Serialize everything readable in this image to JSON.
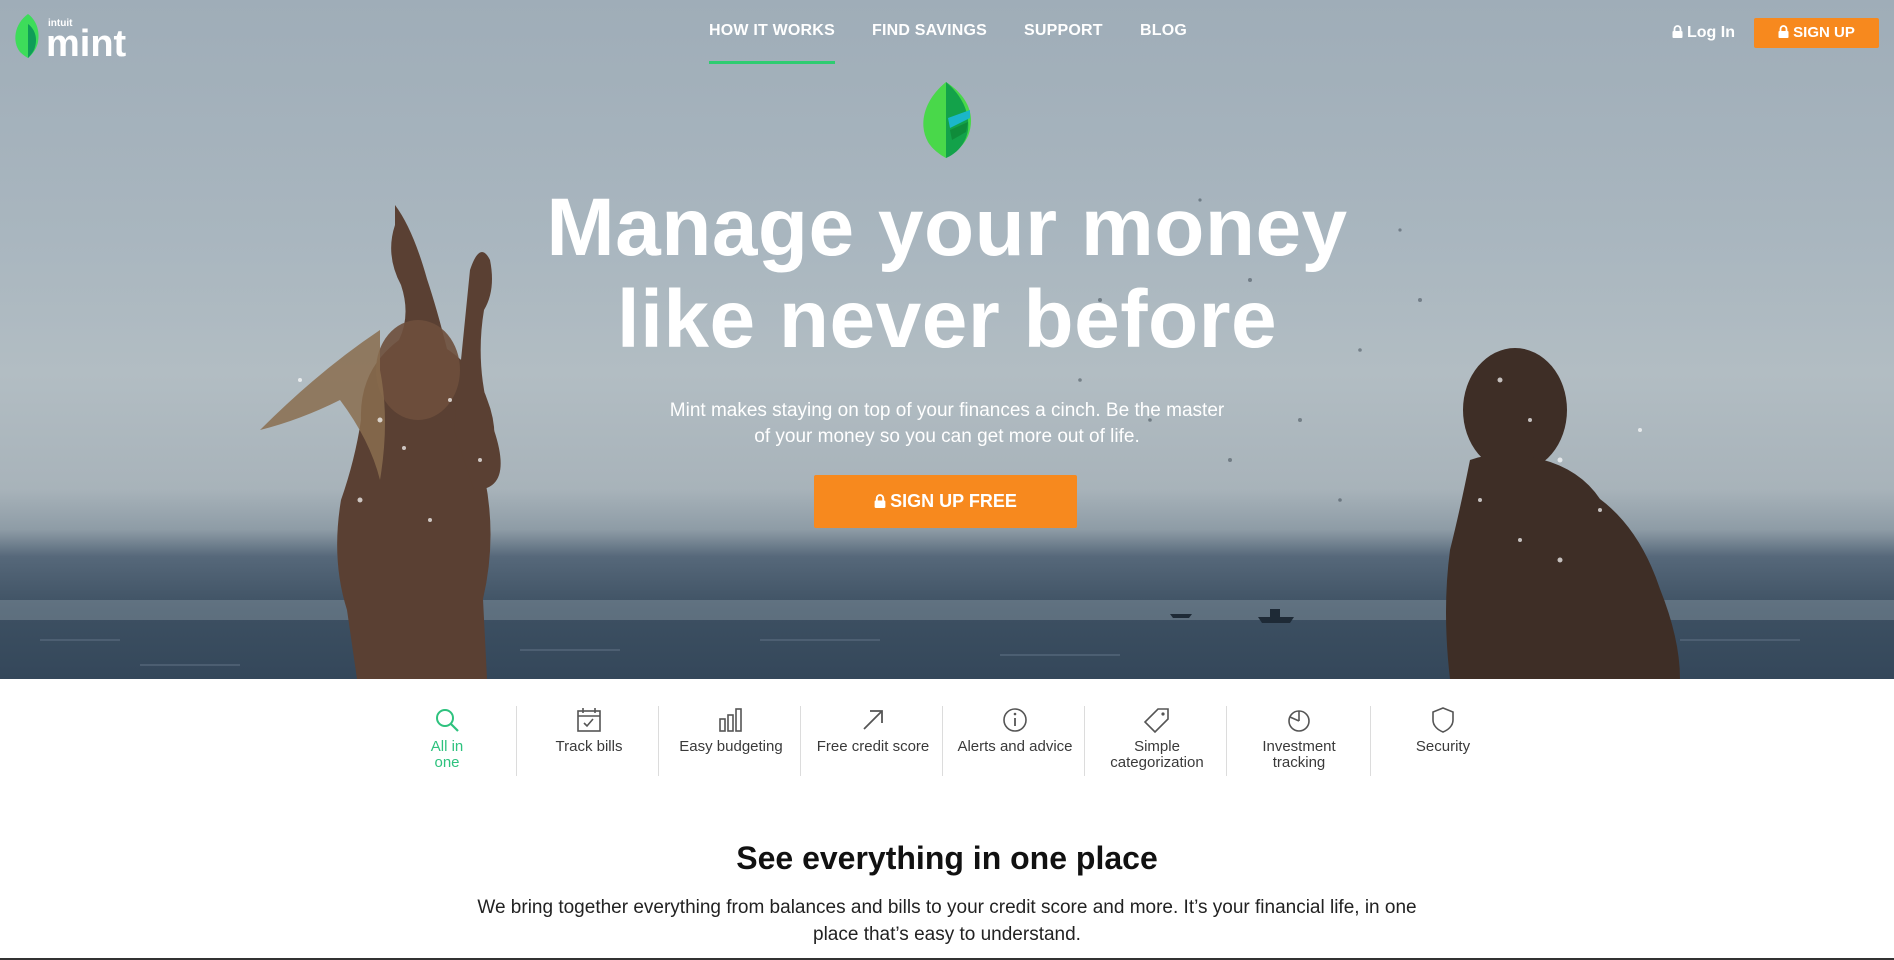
{
  "brand": {
    "small_text": "intuit",
    "name": "mint",
    "colors": {
      "green": "#2ecc71",
      "orange": "#f7891e"
    }
  },
  "nav": {
    "items": [
      {
        "label": "HOW IT WORKS",
        "active": true
      },
      {
        "label": "FIND SAVINGS",
        "active": false
      },
      {
        "label": "SUPPORT",
        "active": false
      },
      {
        "label": "BLOG",
        "active": false
      }
    ],
    "login_label": "Log In",
    "signup_label": "SIGN UP"
  },
  "hero": {
    "headline_line1": "Manage your money",
    "headline_line2": "like never before",
    "subtext_line1": "Mint makes staying on top of your finances a cinch. Be the master",
    "subtext_line2": "of your money so you can get more out of life.",
    "cta_label": "SIGN UP FREE"
  },
  "features": [
    {
      "label": "All in one",
      "icon": "search-icon",
      "active": true
    },
    {
      "label": "Track bills",
      "icon": "calendar-check-icon",
      "active": false
    },
    {
      "label": "Easy budgeting",
      "icon": "bar-chart-icon",
      "active": false
    },
    {
      "label": "Free credit score",
      "icon": "arrow-up-right-icon",
      "active": false
    },
    {
      "label": "Alerts and advice",
      "icon": "info-icon",
      "active": false
    },
    {
      "label": "Simple categorization",
      "icon": "tag-icon",
      "active": false
    },
    {
      "label": "Investment tracking",
      "icon": "pie-chart-icon",
      "active": false
    },
    {
      "label": "Security",
      "icon": "shield-icon",
      "active": false
    }
  ],
  "section": {
    "title": "See everything in one place",
    "text_line1": "We bring together everything from balances and bills to your credit score and more. It’s your financial life, in one",
    "text_line2": "place that’s easy to understand."
  }
}
